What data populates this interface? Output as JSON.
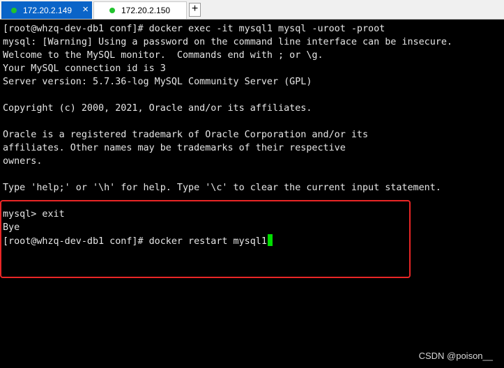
{
  "tabs": [
    {
      "label": "172.20.2.149",
      "close": "×"
    },
    {
      "label": "172.20.2.150"
    }
  ],
  "new_tab_label": "+",
  "terminal": {
    "lines": [
      "[root@whzq-dev-db1 conf]# docker exec -it mysql1 mysql -uroot -proot",
      "mysql: [Warning] Using a password on the command line interface can be insecure.",
      "Welcome to the MySQL monitor.  Commands end with ; or \\g.",
      "Your MySQL connection id is 3",
      "Server version: 5.7.36-log MySQL Community Server (GPL)",
      "",
      "Copyright (c) 2000, 2021, Oracle and/or its affiliates.",
      "",
      "Oracle is a registered trademark of Oracle Corporation and/or its",
      "affiliates. Other names may be trademarks of their respective",
      "owners.",
      "",
      "Type 'help;' or '\\h' for help. Type '\\c' to clear the current input statement.",
      "",
      "mysql> exit",
      "Bye",
      "[root@whzq-dev-db1 conf]# docker restart mysql1"
    ]
  },
  "watermark": "CSDN @poison__",
  "colors": {
    "tab_active": "#0a64c8",
    "status_dot": "#22c32e",
    "cursor": "#00dd00",
    "highlight": "#ea2626"
  }
}
